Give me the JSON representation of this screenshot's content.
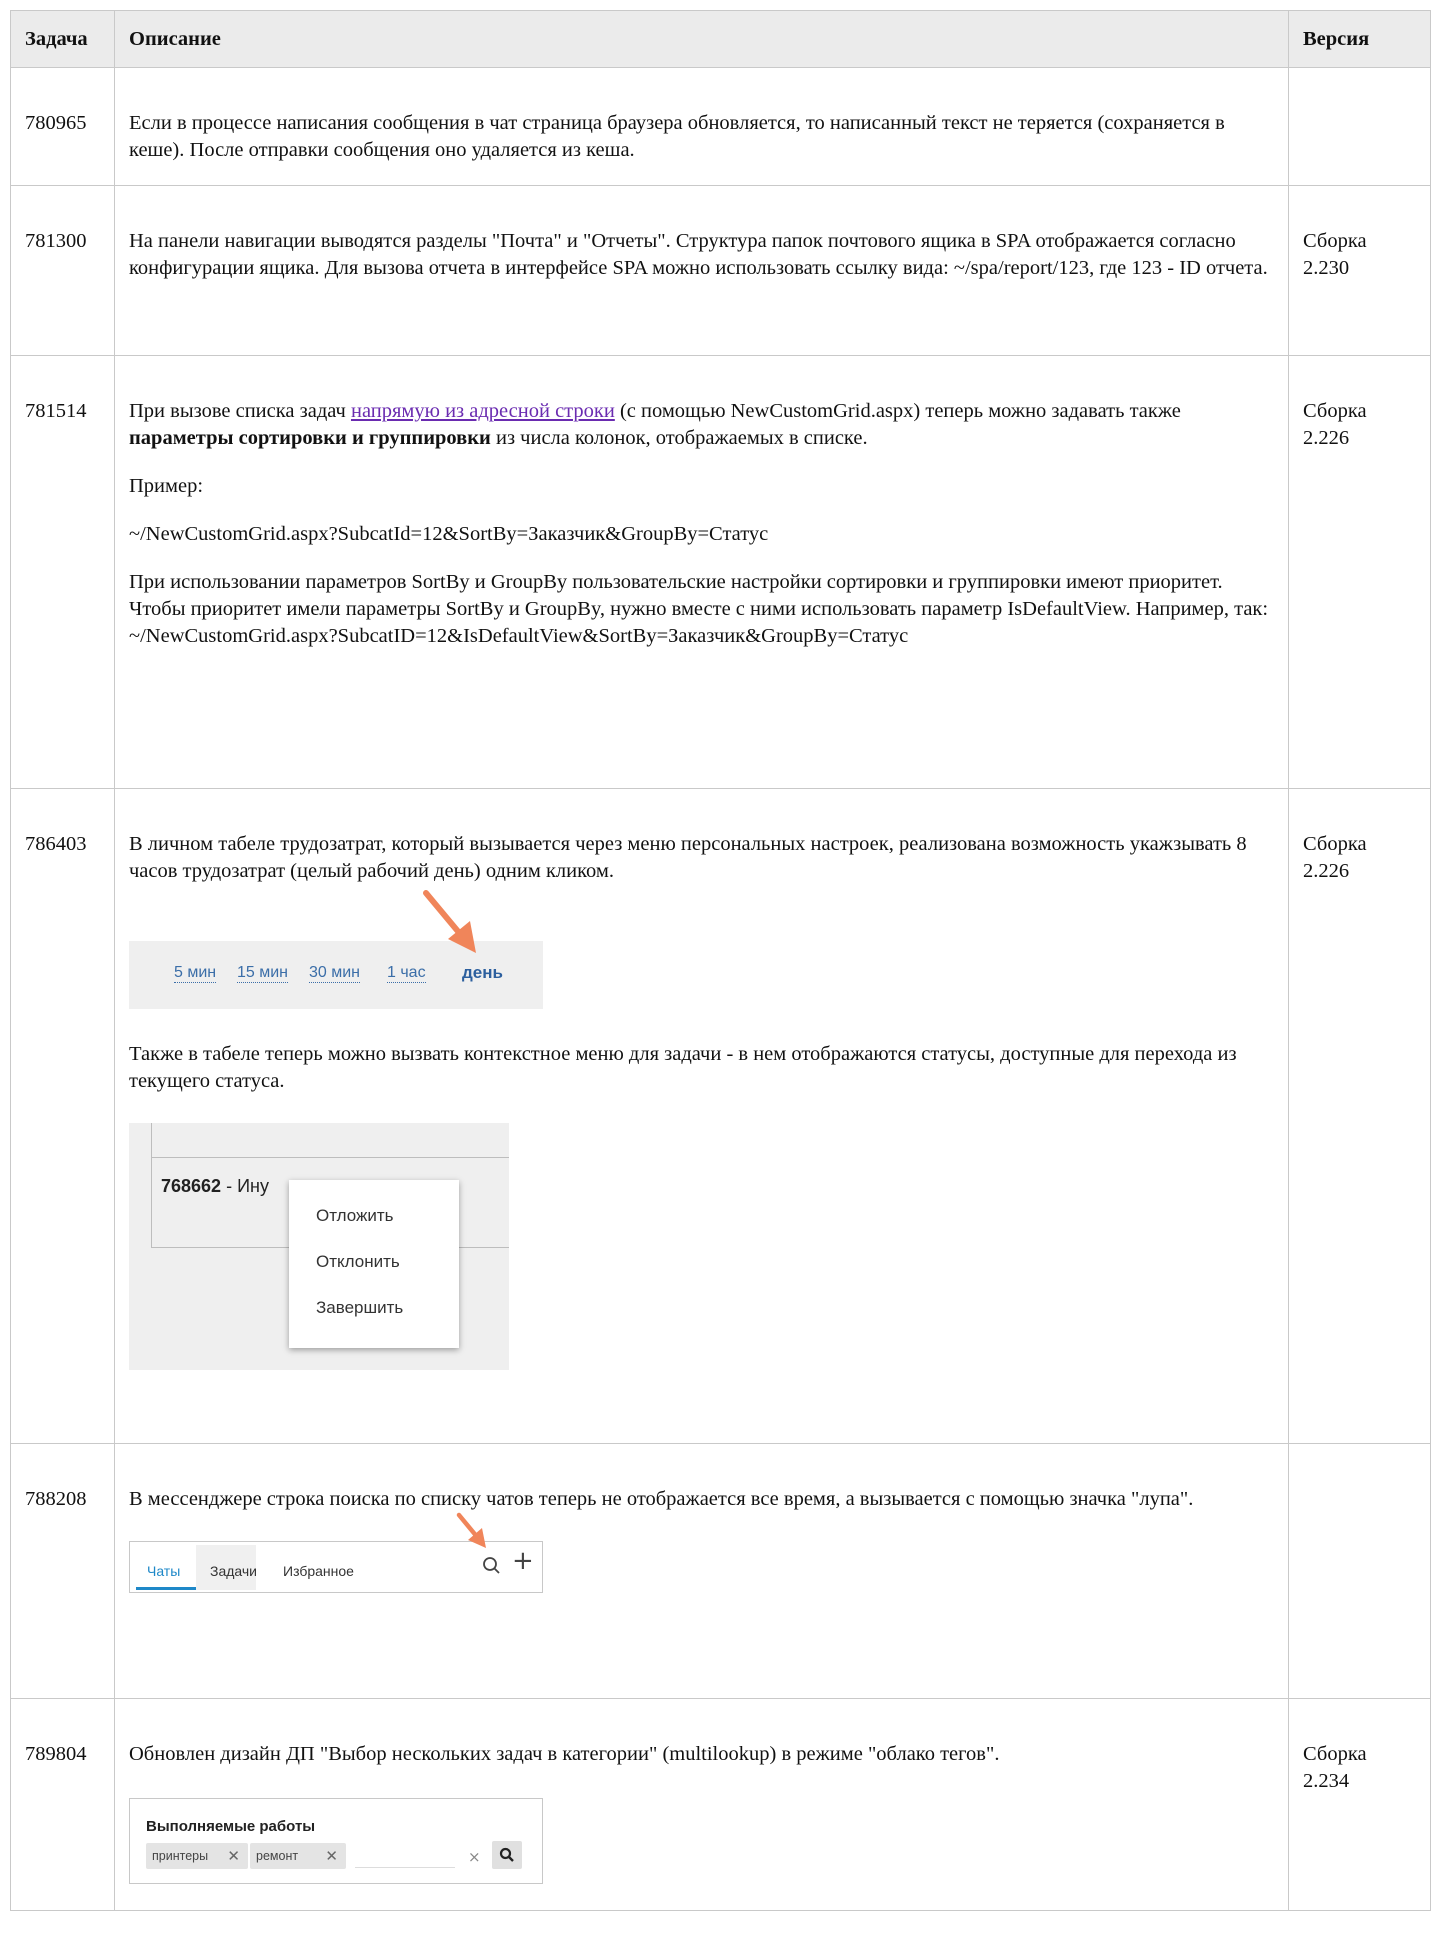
{
  "headers": {
    "task": "Задача",
    "description": "Описание",
    "version": "Версия"
  },
  "rows": [
    {
      "id": "780965",
      "text": "Если в процессе написания сообщения в чат страница браузера обновляется, то написанный текст не теряется (сохраняется в кеше). После отправки сообщения оно удаляется из кеша.",
      "version": ""
    },
    {
      "id": "781300",
      "text": "На панели навигации выводятся разделы \"Почта\" и \"Отчеты\". Структура папок почтового ящика в SPA отображается согласно конфигурации ящика. Для вызова отчета в интерфейсе SPA можно использовать ссылку вида: ~/spa/report/123, где 123 - ID отчета.",
      "version": "Сборка 2.230"
    },
    {
      "id": "781514",
      "p1_before": "При вызове списка задач ",
      "p1_link": "напрямую из адресной строки",
      "p1_mid": " (с помощью NewCustomGrid.aspx) теперь можно задавать также ",
      "p1_bold": "параметры сортировки и группировки",
      "p1_after": " из числа колонок, отображаемых в списке.",
      "p2": "Пример:",
      "p3": "~/NewCustomGrid.aspx?SubcatId=12&SortBy=Заказчик&GroupBy=Статус",
      "p4": "При использовании параметров SortBy и GroupBy пользовательские настройки сортировки и группировки имеют приоритет. Чтобы приоритет имели параметры SortBy и GroupBy, нужно вместе с ними использовать параметр IsDefaultView. Например, так: ~/NewCustomGrid.aspx?SubcatID=12&IsDefaultView&SortBy=Заказчик&GroupBy=Статус",
      "version": "Сборка 2.226"
    },
    {
      "id": "786403",
      "p1": "В личном табеле трудозатрат, который вызывается через меню персональных настроек, реализована возможность укажзывать 8 часов трудозатрат (целый рабочий день) одним кликом.",
      "time_options": [
        "5 мин",
        "15 мин",
        "30 мин",
        "1 час"
      ],
      "time_day": "день",
      "p2": "Также в табеле теперь можно вызвать контекстное меню для задачи - в нем отображаются статусы, доступные для перехода из текущего статуса.",
      "ctx_task_id": "768662",
      "ctx_task_rest": " - Ину",
      "ctx_menu": [
        "Отложить",
        "Отклонить",
        "Завершить"
      ],
      "version": "Сборка 2.226"
    },
    {
      "id": "788208",
      "text": "В мессенджере строка поиска по списку чатов теперь не отображается все время, а вызывается с помощью значка \"лупа\".",
      "tabs": [
        "Чаты",
        "Задачи",
        "Избранное"
      ],
      "plus": "+",
      "version": ""
    },
    {
      "id": "789804",
      "text": "Обновлен дизайн ДП \"Выбор нескольких задач в категории\" (multilookup) в режиме \"облако тегов\".",
      "ml_title": "Выполняемые работы",
      "ml_tags": [
        "принтеры",
        "ремонт"
      ],
      "ml_tag_x": "✕",
      "ml_clear": "×",
      "version": "Сборка 2.234"
    }
  ],
  "colors": {
    "arrow": "#f0855a",
    "link": "#6a2bb0",
    "tab_active": "#1e88c8"
  }
}
